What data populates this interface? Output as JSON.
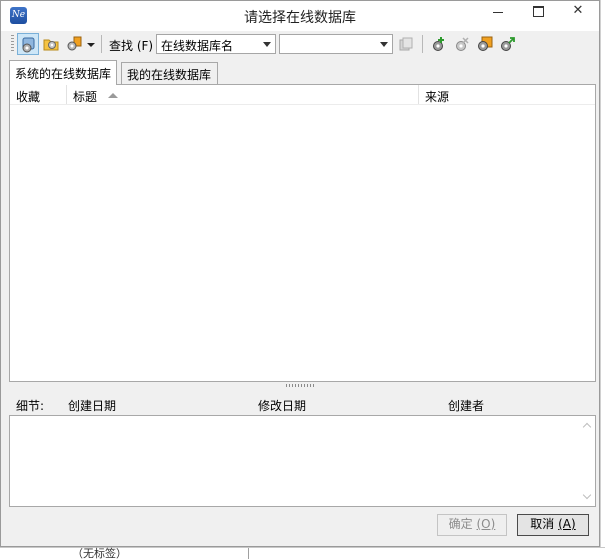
{
  "window": {
    "title": "请选择在线数据库",
    "app_icon_text": "Ne"
  },
  "toolbar": {
    "find_label": "查找 (F)",
    "search_field_value": "在线数据库名",
    "search_text_value": ""
  },
  "tabs": [
    {
      "label": "系统的在线数据库",
      "selected": true
    },
    {
      "label": "我的在线数据库",
      "selected": false
    }
  ],
  "list": {
    "columns": [
      "收藏",
      "标题",
      "来源"
    ],
    "sorted_column": "标题",
    "rows": []
  },
  "details": {
    "label": "细节:",
    "fields": [
      "创建日期",
      "修改日期",
      "创建者"
    ]
  },
  "buttons": {
    "ok": {
      "label": "确定 ",
      "key": "(O)",
      "enabled": false
    },
    "cancel": {
      "label": "取消 ",
      "key": "(A)",
      "enabled": true
    }
  },
  "background": {
    "fragment_text": "（无标签）"
  },
  "colors": {
    "accent": "#cde6f7",
    "icon_orange": "#f0a020",
    "icon_blue": "#3f74c8"
  }
}
